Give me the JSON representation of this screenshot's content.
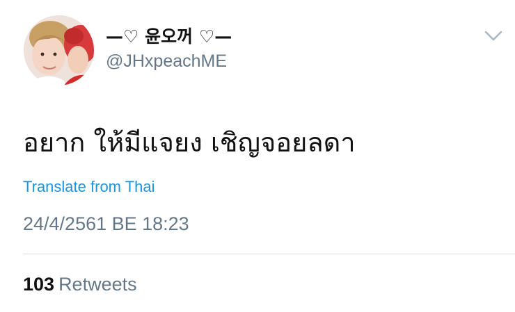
{
  "author": {
    "display_name": "—♡ 윤오꺼 ♡—",
    "handle": "@JHxpeachME",
    "avatar_icon": "profile-photo"
  },
  "tweet": {
    "text": "อยาก ให้มีแจยง เชิญจอยลดา",
    "translate_label": "Translate from Thai",
    "timestamp": "24/4/2561 BE 18:23"
  },
  "stats": {
    "retweet_count": "103",
    "retweet_label": "Retweets"
  },
  "colors": {
    "link": "#1b95e0",
    "secondary_text": "#657786",
    "primary_text": "#111111",
    "divider": "#d8dee3"
  },
  "menu": {
    "icon": "chevron-down-icon"
  }
}
